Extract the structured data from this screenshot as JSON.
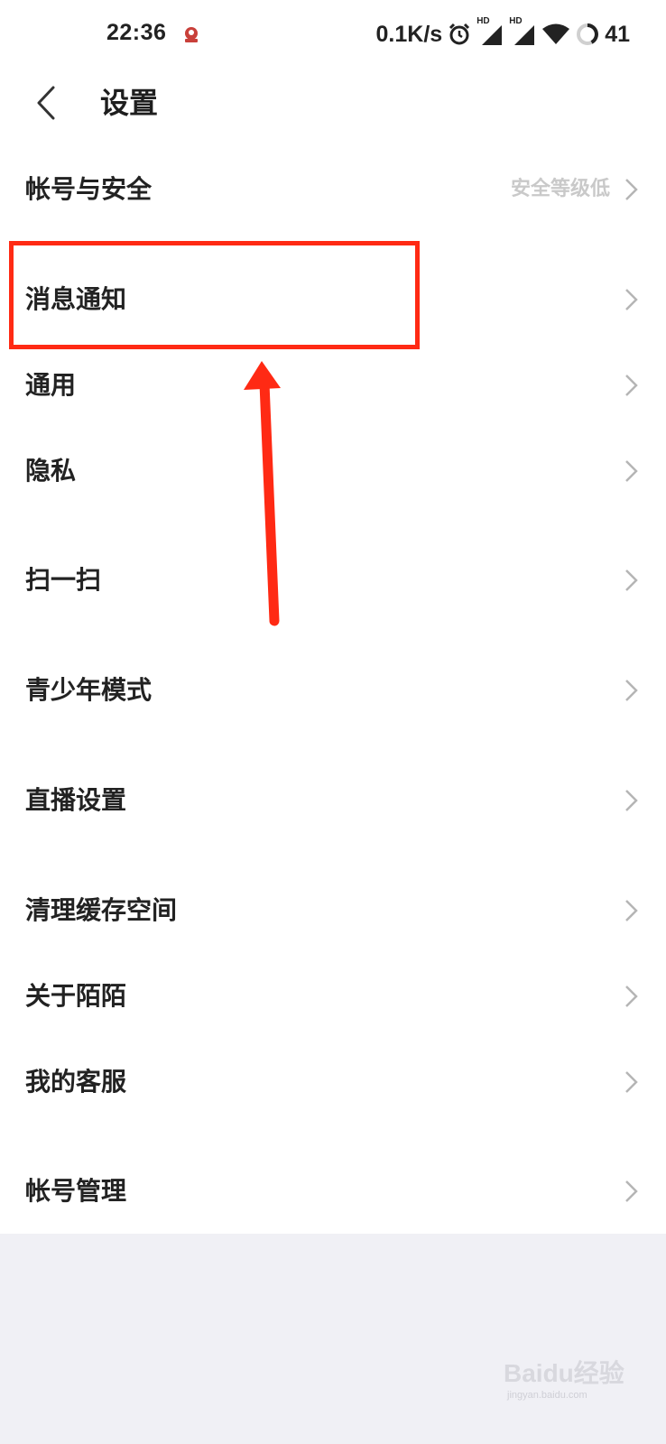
{
  "statusbar": {
    "time": "22:36",
    "net_speed": "0.1K/s",
    "sim1_tag": "HD",
    "sim2_tag": "HD",
    "battery": "41",
    "icons": [
      "app-notification-icon",
      "alarm-icon",
      "signal-icon",
      "signal-icon",
      "wifi-icon",
      "battery-ring-icon"
    ]
  },
  "header": {
    "back_icon": "chevron-left-icon",
    "title": "设置"
  },
  "settings": {
    "items": [
      {
        "label": "帐号与安全",
        "value": "安全等级低"
      },
      {
        "label": "消息通知",
        "value": ""
      },
      {
        "label": "通用",
        "value": ""
      },
      {
        "label": "隐私",
        "value": ""
      },
      {
        "label": "扫一扫",
        "value": ""
      },
      {
        "label": "青少年模式",
        "value": ""
      },
      {
        "label": "直播设置",
        "value": ""
      },
      {
        "label": "清理缓存空间",
        "value": ""
      },
      {
        "label": "关于陌陌",
        "value": ""
      },
      {
        "label": "我的客服",
        "value": ""
      },
      {
        "label": "帐号管理",
        "value": ""
      }
    ]
  },
  "annotation": {
    "color": "#ff2a14",
    "highlighted_item": "消息通知"
  },
  "watermark": {
    "text": "Baidu经验",
    "sub": "jingyan.baidu.com"
  }
}
